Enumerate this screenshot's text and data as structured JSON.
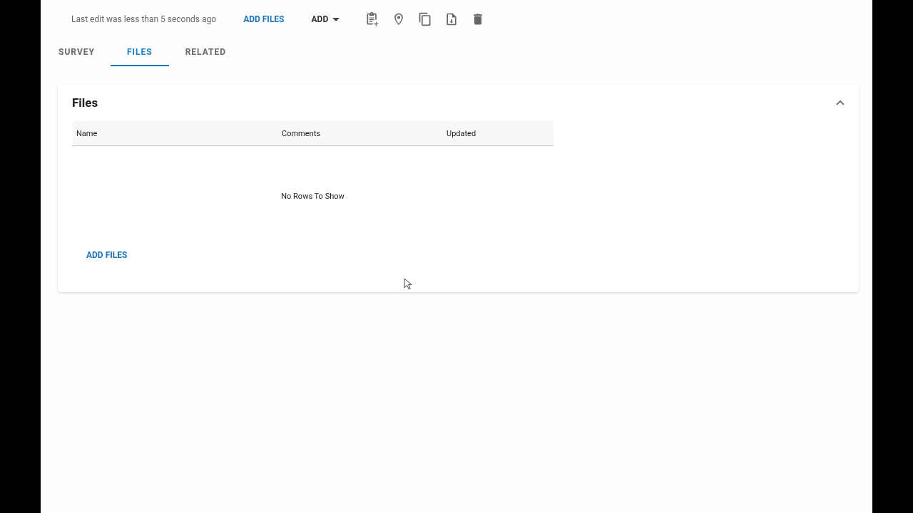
{
  "toolbar": {
    "status": "Last edit was less than 5 seconds ago",
    "add_files_button": "ADD FILES",
    "add_menu": "ADD"
  },
  "tabs": [
    {
      "label": "SURVEY",
      "selected": false
    },
    {
      "label": "FILES",
      "selected": true
    },
    {
      "label": "RELATED",
      "selected": false
    }
  ],
  "files_panel": {
    "title": "Files",
    "expanded": true,
    "table": {
      "columns": [
        "Name",
        "Comments",
        "Updated"
      ],
      "empty_message": "No Rows To Show"
    },
    "add_files_button": "ADD FILES"
  }
}
